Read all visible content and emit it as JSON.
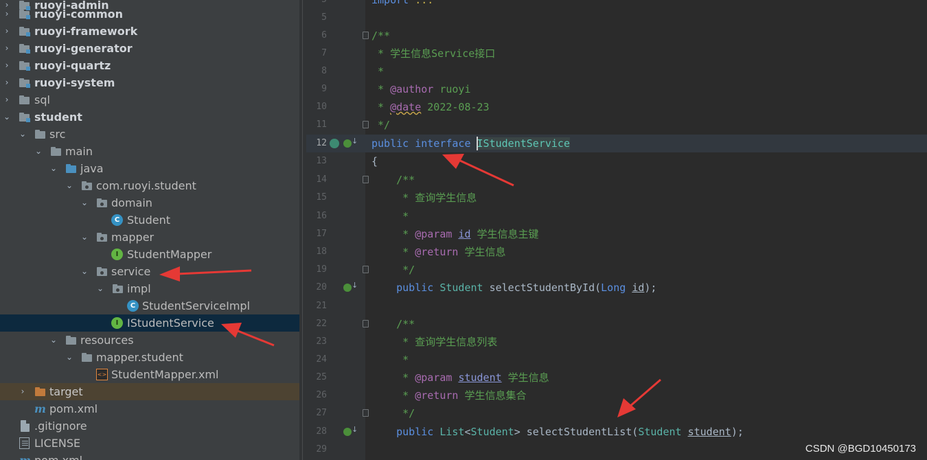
{
  "project_tree": {
    "items": [
      {
        "label": "ruoyi-admin",
        "kind": "module",
        "expanded": false
      },
      {
        "label": "ruoyi-common",
        "kind": "module",
        "expanded": false
      },
      {
        "label": "ruoyi-framework",
        "kind": "module",
        "expanded": false
      },
      {
        "label": "ruoyi-generator",
        "kind": "module",
        "expanded": false
      },
      {
        "label": "ruoyi-quartz",
        "kind": "module",
        "expanded": false
      },
      {
        "label": "ruoyi-system",
        "kind": "module",
        "expanded": false
      },
      {
        "label": "sql",
        "kind": "folder",
        "expanded": false
      },
      {
        "label": "student",
        "kind": "module",
        "expanded": true
      },
      {
        "label": "src",
        "kind": "folder",
        "expanded": true
      },
      {
        "label": "main",
        "kind": "folder",
        "expanded": true
      },
      {
        "label": "java",
        "kind": "source-folder",
        "expanded": true
      },
      {
        "label": "com.ruoyi.student",
        "kind": "package",
        "expanded": true
      },
      {
        "label": "domain",
        "kind": "package",
        "expanded": true
      },
      {
        "label": "Student",
        "kind": "class"
      },
      {
        "label": "mapper",
        "kind": "package",
        "expanded": true
      },
      {
        "label": "StudentMapper",
        "kind": "interface"
      },
      {
        "label": "service",
        "kind": "package",
        "expanded": true
      },
      {
        "label": "impl",
        "kind": "package",
        "expanded": true
      },
      {
        "label": "StudentServiceImpl",
        "kind": "class"
      },
      {
        "label": "IStudentService",
        "kind": "interface",
        "selected": true
      },
      {
        "label": "resources",
        "kind": "resources-folder",
        "expanded": true
      },
      {
        "label": "mapper.student",
        "kind": "folder",
        "expanded": true
      },
      {
        "label": "StudentMapper.xml",
        "kind": "xml"
      },
      {
        "label": "target",
        "kind": "excluded-folder",
        "expanded": false
      },
      {
        "label": "pom.xml",
        "kind": "maven"
      },
      {
        "label": ".gitignore",
        "kind": "file"
      },
      {
        "label": "LICENSE",
        "kind": "file"
      },
      {
        "label": "pom.xml",
        "kind": "maven"
      }
    ]
  },
  "editor": {
    "lines": [
      {
        "num": "5",
        "text": "import ..."
      },
      {
        "num": "6",
        "text": "/**"
      },
      {
        "num": "7",
        "text": " * 学生信息Service接口"
      },
      {
        "num": "8",
        "text": " *"
      },
      {
        "num": "9",
        "text": " * @author ruoyi"
      },
      {
        "num": "10",
        "text": " * @date 2022-08-23"
      },
      {
        "num": "11",
        "text": " */"
      },
      {
        "num": "12",
        "text": "public interface IStudentService"
      },
      {
        "num": "13",
        "text": "{"
      },
      {
        "num": "14",
        "text": "    /**"
      },
      {
        "num": "15",
        "text": "     * 查询学生信息"
      },
      {
        "num": "16",
        "text": "     *"
      },
      {
        "num": "17",
        "text": "     * @param id 学生信息主键"
      },
      {
        "num": "18",
        "text": "     * @return 学生信息"
      },
      {
        "num": "19",
        "text": "     */"
      },
      {
        "num": "20",
        "text": "    public Student selectStudentById(Long id);"
      },
      {
        "num": "21",
        "text": ""
      },
      {
        "num": "22",
        "text": "    /**"
      },
      {
        "num": "23",
        "text": "     * 查询学生信息列表"
      },
      {
        "num": "24",
        "text": "     *"
      },
      {
        "num": "25",
        "text": "     * @param student 学生信息"
      },
      {
        "num": "26",
        "text": "     * @return 学生信息集合"
      },
      {
        "num": "27",
        "text": "     */"
      },
      {
        "num": "28",
        "text": "    public List<Student> selectStudentList(Student student);"
      },
      {
        "num": "29",
        "text": ""
      }
    ]
  },
  "watermark": "CSDN @BGD10450173",
  "colors": {
    "arrow": "#e53935",
    "keyword": "#5b8fe0",
    "comment": "#5a9e52",
    "doc_tag": "#a86bb0",
    "type": "#5ab3a8"
  }
}
